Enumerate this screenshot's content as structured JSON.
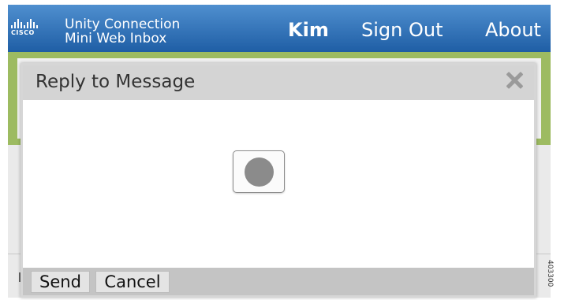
{
  "header": {
    "logo_text": "CISCO",
    "app_title_line1": "Unity Connection",
    "app_title_line2": "Mini Web Inbox",
    "user_name": "Kim",
    "sign_out_label": "Sign Out",
    "about_label": "About"
  },
  "dialog": {
    "title": "Reply to Message",
    "send_label": "Send",
    "cancel_label": "Cancel"
  },
  "figure_code": "403300",
  "colors": {
    "header_blue": "#1f5ea5",
    "accent_green": "#9dbb61",
    "dialog_header_gray": "#d4d4d4"
  }
}
